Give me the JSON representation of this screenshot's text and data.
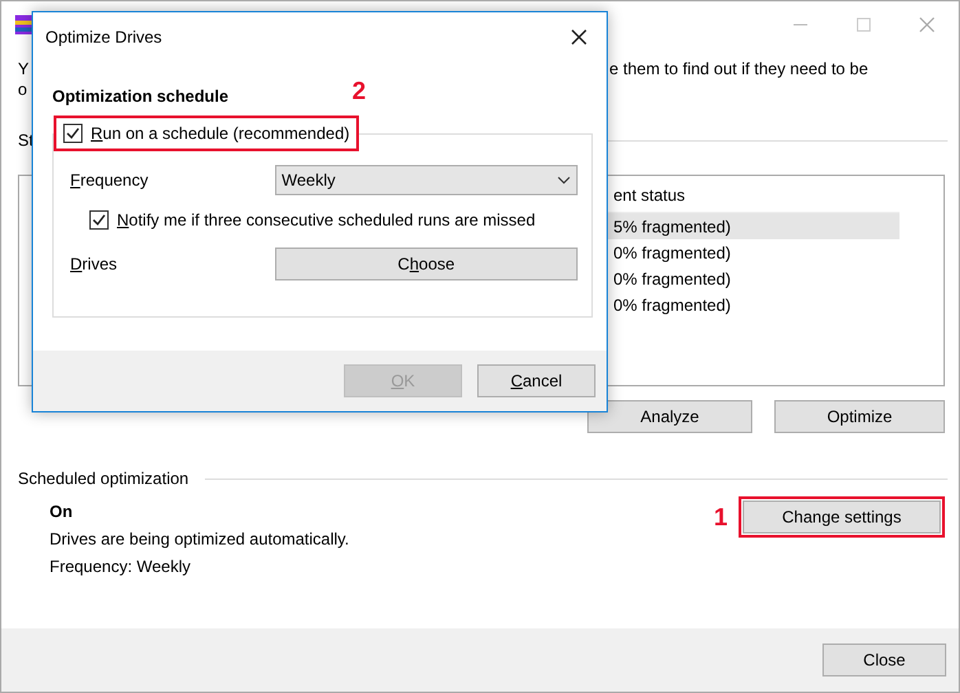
{
  "main_window": {
    "description": {
      "left_fragments": [
        "Y",
        "o"
      ],
      "right_fragment": "e them to find out if they need to be"
    },
    "status_fragment": "St",
    "drive_list": {
      "column_header": "ent status",
      "rows": [
        {
          "status": "5% fragmented)",
          "selected": true
        },
        {
          "status": "0% fragmented)",
          "selected": false
        },
        {
          "status": "0% fragmented)",
          "selected": false
        },
        {
          "status": "0% fragmented)",
          "selected": false
        }
      ]
    },
    "buttons": [
      {
        "label": "Analyze"
      },
      {
        "label": "Optimize"
      }
    ],
    "scheduled": {
      "heading": "Scheduled optimization",
      "state": "On",
      "description": "Drives are being optimized automatically.",
      "frequency": "Frequency: Weekly",
      "button": {
        "label": "Change settings",
        "highlighted": true
      },
      "callout": "1"
    },
    "footer_button": "Close"
  },
  "dialog": {
    "title": "Optimize Drives",
    "heading": "Optimization schedule",
    "callout": "2",
    "run_on_schedule": {
      "key": "R",
      "post": "un on a schedule (recommended)",
      "checked": true,
      "highlighted": true
    },
    "frequency": {
      "label": {
        "key": "F",
        "post": "requency"
      },
      "value": "Weekly"
    },
    "notify": {
      "key": "N",
      "post": "otify me if three consecutive scheduled runs are missed",
      "checked": true
    },
    "drives": {
      "label": {
        "key": "D",
        "post": "rives"
      },
      "button": {
        "pre": "C",
        "key": "h",
        "post": "oose"
      }
    },
    "buttons": [
      {
        "key": "O",
        "post": "K",
        "disabled": true
      },
      {
        "key": "C",
        "post": "ancel",
        "disabled": false
      }
    ]
  }
}
